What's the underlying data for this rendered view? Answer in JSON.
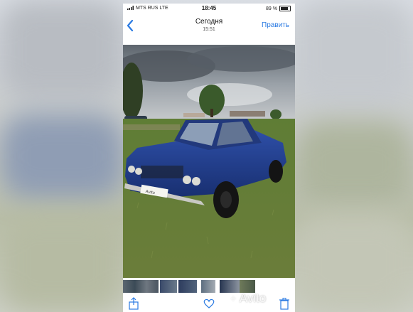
{
  "status_bar": {
    "carrier": "MTS RUS  LTE",
    "time": "18:45",
    "battery": "89 %"
  },
  "nav": {
    "title": "Сегодня",
    "subtitle": "15:51",
    "edit_label": "Править",
    "back_icon": "chevron-left-icon"
  },
  "photo": {
    "plate_text": "Avito"
  },
  "toolbar": {
    "share_icon": "share-icon",
    "favorite_icon": "heart-icon",
    "delete_icon": "trash-icon"
  },
  "watermark": "Avito",
  "colors": {
    "accent": "#2a7ae2",
    "car_body": "#1f3c8a",
    "grass": "#5f7a35",
    "sky": "#8a939b"
  }
}
